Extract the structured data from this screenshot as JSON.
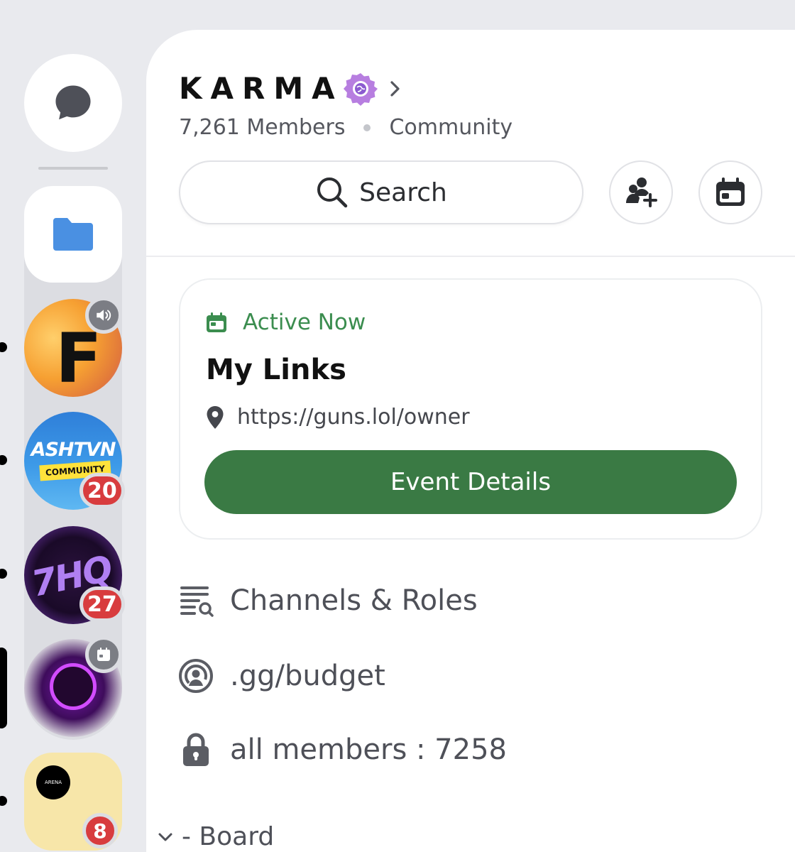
{
  "guild": {
    "name": "KARMA",
    "member_count": "7,261 Members",
    "type": "Community"
  },
  "search": {
    "label": "Search"
  },
  "event": {
    "status": "Active Now",
    "title": "My Links",
    "location": "https://guns.lol/owner",
    "button_label": "Event Details"
  },
  "channels": [
    {
      "label": "Channels & Roles",
      "icon": "channels-browse-icon"
    },
    {
      "label": ".gg/budget",
      "icon": "stage-icon"
    },
    {
      "label": "all members : 7258",
      "icon": "lock-icon"
    }
  ],
  "category": {
    "label": "- Board"
  },
  "servers": {
    "fortnite": {
      "letter": "F"
    },
    "ashtvn": {
      "name": "ASHTVN",
      "sub": "COMMUNITY",
      "badge": "20"
    },
    "hq": {
      "name": "7HQ",
      "badge": "27"
    },
    "arena": {
      "mini": "ARENA"
    },
    "last": {
      "badge": "8"
    }
  },
  "colors": {
    "accent_green": "#3a7a44",
    "status_green": "#3b8d4f",
    "badge_red": "#d83c3e",
    "folder_blue": "#4a90e2",
    "verified_purple": "#b77ee0"
  }
}
